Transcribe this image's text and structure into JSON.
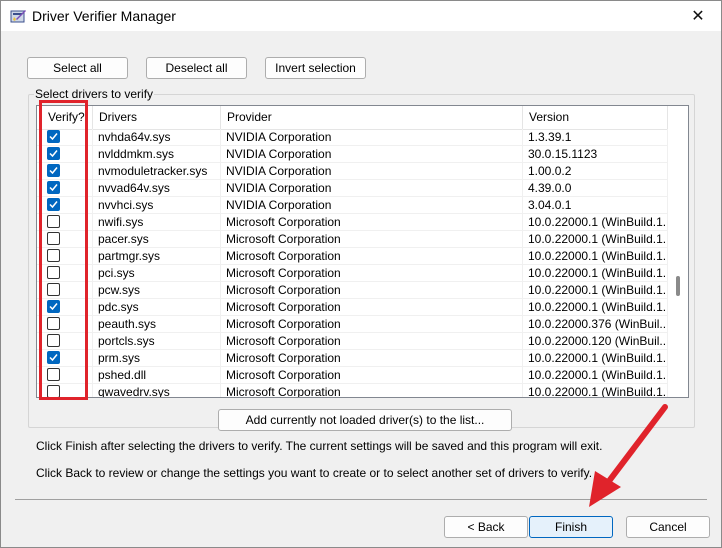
{
  "window": {
    "title": "Driver Verifier Manager",
    "close_glyph": "✕"
  },
  "toolbar": {
    "select_all": "Select all",
    "deselect_all": "Deselect all",
    "invert_selection": "Invert selection"
  },
  "group": {
    "label": "Select drivers to verify"
  },
  "table": {
    "columns": [
      "Verify?",
      "Drivers",
      "Provider",
      "Version"
    ],
    "rows": [
      {
        "verify": true,
        "driver": "nvhda64v.sys",
        "provider": "NVIDIA Corporation",
        "version": "1.3.39.1"
      },
      {
        "verify": true,
        "driver": "nvlddmkm.sys",
        "provider": "NVIDIA Corporation",
        "version": "30.0.15.1123"
      },
      {
        "verify": true,
        "driver": "nvmoduletracker.sys",
        "provider": "NVIDIA Corporation",
        "version": "1.00.0.2"
      },
      {
        "verify": true,
        "driver": "nvvad64v.sys",
        "provider": "NVIDIA Corporation",
        "version": "4.39.0.0"
      },
      {
        "verify": true,
        "driver": "nvvhci.sys",
        "provider": "NVIDIA Corporation",
        "version": "3.04.0.1"
      },
      {
        "verify": false,
        "driver": "nwifi.sys",
        "provider": "Microsoft Corporation",
        "version": "10.0.22000.1 (WinBuild.1..."
      },
      {
        "verify": false,
        "driver": "pacer.sys",
        "provider": "Microsoft Corporation",
        "version": "10.0.22000.1 (WinBuild.1..."
      },
      {
        "verify": false,
        "driver": "partmgr.sys",
        "provider": "Microsoft Corporation",
        "version": "10.0.22000.1 (WinBuild.1..."
      },
      {
        "verify": false,
        "driver": "pci.sys",
        "provider": "Microsoft Corporation",
        "version": "10.0.22000.1 (WinBuild.1..."
      },
      {
        "verify": false,
        "driver": "pcw.sys",
        "provider": "Microsoft Corporation",
        "version": "10.0.22000.1 (WinBuild.1..."
      },
      {
        "verify": true,
        "driver": "pdc.sys",
        "provider": "Microsoft Corporation",
        "version": "10.0.22000.1 (WinBuild.1..."
      },
      {
        "verify": false,
        "driver": "peauth.sys",
        "provider": "Microsoft Corporation",
        "version": "10.0.22000.376 (WinBuil..."
      },
      {
        "verify": false,
        "driver": "portcls.sys",
        "provider": "Microsoft Corporation",
        "version": "10.0.22000.120 (WinBuil..."
      },
      {
        "verify": true,
        "driver": "prm.sys",
        "provider": "Microsoft Corporation",
        "version": "10.0.22000.1 (WinBuild.1..."
      },
      {
        "verify": false,
        "driver": "pshed.dll",
        "provider": "Microsoft Corporation",
        "version": "10.0.22000.1 (WinBuild.1..."
      },
      {
        "verify": false,
        "driver": "qwavedrv.sys",
        "provider": "Microsoft Corporation",
        "version": "10.0.22000.1 (WinBuild.1..."
      }
    ]
  },
  "add_drivers_button": "Add currently not loaded driver(s) to the list...",
  "info": {
    "finish_hint": "Click Finish after selecting the drivers to verify. The current settings will be saved and this program will exit.",
    "back_hint": "Click Back to review or change the settings you want to create or to select another set of drivers to verify."
  },
  "footer": {
    "back": "< Back",
    "finish": "Finish",
    "cancel": "Cancel"
  },
  "icons": {
    "app": "driver-verifier-icon",
    "close": "close-icon",
    "checkbox_checked": "checkmark-icon",
    "annotation_arrow": "red-arrow-icon"
  },
  "colors": {
    "accent": "#0067c0",
    "annotation": "#e0232b"
  }
}
